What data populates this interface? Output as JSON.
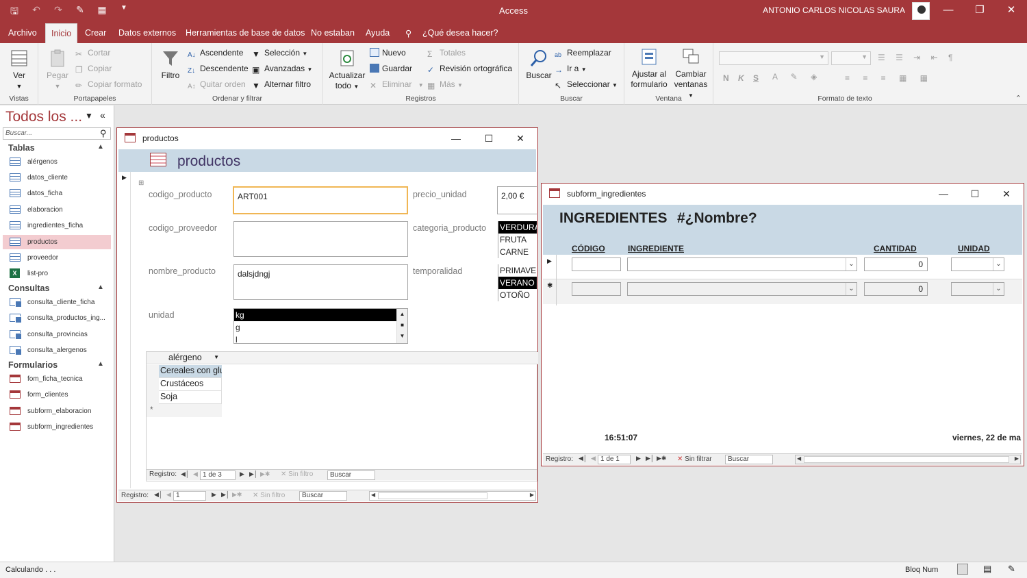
{
  "app": {
    "title": "Access",
    "user": "ANTONIO CARLOS NICOLAS SAURA"
  },
  "menu": [
    "Archivo",
    "Inicio",
    "Crear",
    "Datos externos",
    "Herramientas de base de datos",
    "No estaban",
    "Ayuda",
    "¿Qué desea hacer?"
  ],
  "ribbon": {
    "vistas": {
      "ver": "Ver",
      "label": "Vistas"
    },
    "portapapeles": {
      "pegar": "Pegar",
      "cortar": "Cortar",
      "copiar": "Copiar",
      "copiar_formato": "Copiar formato",
      "label": "Portapapeles"
    },
    "ordenar": {
      "filtro": "Filtro",
      "ascendente": "Ascendente",
      "descendente": "Descendente",
      "quitar_orden": "Quitar orden",
      "seleccion": "Selección",
      "avanzadas": "Avanzadas",
      "alternar": "Alternar filtro",
      "label": "Ordenar y filtrar"
    },
    "registros": {
      "actualizar": "Actualizar",
      "todo": "todo",
      "nuevo": "Nuevo",
      "guardar": "Guardar",
      "eliminar": "Eliminar",
      "totales": "Totales",
      "revision": "Revisión ortográfica",
      "mas": "Más",
      "label": "Registros"
    },
    "buscar": {
      "buscar": "Buscar",
      "reemplazar": "Reemplazar",
      "ir_a": "Ir a",
      "seleccionar": "Seleccionar",
      "label": "Buscar"
    },
    "ventana": {
      "ajustar": "Ajustar al",
      "formulario": "formulario",
      "cambiar": "Cambiar",
      "ventanas": "ventanas",
      "label": "Ventana"
    },
    "formato": {
      "n": "N",
      "k": "K",
      "s": "S",
      "label": "Formato de texto"
    }
  },
  "nav": {
    "title": "Todos los ...",
    "search_placeholder": "Buscar...",
    "sections": {
      "tablas": "Tablas",
      "consultas": "Consultas",
      "formularios": "Formularios"
    },
    "tablas": [
      "alérgenos",
      "datos_cliente",
      "datos_ficha",
      "elaboracion",
      "ingredientes_ficha",
      "productos",
      "proveedor",
      "list-pro"
    ],
    "consultas": [
      "consulta_cliente_ficha",
      "consulta_productos_ing...",
      "consulta_provincias",
      "consulta_alergenos"
    ],
    "formularios": [
      "fom_ficha_tecnica",
      "form_clientes",
      "subform_elaboracion",
      "subform_ingredientes"
    ]
  },
  "productos": {
    "window_title": "productos",
    "header": "productos",
    "labels": {
      "codigo_producto": "codigo_producto",
      "codigo_proveedor": "codigo_proveedor",
      "nombre_producto": "nombre_producto",
      "unidad": "unidad",
      "precio_unidad": "precio_unidad",
      "categoria_producto": "categoria_producto",
      "temporalidad": "temporalidad"
    },
    "values": {
      "codigo_producto": "ART001",
      "codigo_proveedor": "",
      "nombre_producto": "dalsjdngj",
      "precio_unidad": "2,00 €"
    },
    "unidad_options": [
      "kg",
      "g",
      "l"
    ],
    "categoria_options": [
      "VERDURA",
      "FRUTA",
      "CARNE"
    ],
    "temporalidad_options": [
      "PRIMAVE",
      "VERANO",
      "OTOÑO"
    ],
    "sub": {
      "column": "alérgeno",
      "rows": [
        "Cereales con glu",
        "Crustáceos",
        "Soja"
      ],
      "new_row": "*",
      "nav": {
        "registro": "Registro:",
        "pos": "1 de 3",
        "filtro": "Sin filtro",
        "buscar": "Buscar"
      }
    },
    "nav": {
      "registro": "Registro:",
      "pos": "1",
      "filtro": "Sin filtro",
      "buscar": "Buscar"
    }
  },
  "ingredientes": {
    "window_title": "subform_ingredientes",
    "heading": "INGREDIENTES",
    "heading_value": "#¿Nombre?",
    "columns": [
      "CÓDIGO",
      "INGREDIENTE",
      "CANTIDAD",
      "UNIDAD"
    ],
    "rows": [
      {
        "codigo": "",
        "ingrediente": "",
        "cantidad": "0",
        "unidad": ""
      },
      {
        "codigo": "",
        "ingrediente": "",
        "cantidad": "0",
        "unidad": ""
      }
    ],
    "time": "16:51:07",
    "date": "viernes, 22 de ma",
    "nav": {
      "registro": "Registro:",
      "pos": "1 de 1",
      "filtro": "Sin filtrar",
      "buscar": "Buscar"
    }
  },
  "status": {
    "left": "Calculando . . .",
    "right": "Bloq Num"
  },
  "colors": {
    "accent": "#a4373a",
    "header_blue": "#c9d9e5",
    "selected_nav": "#f3ccd0"
  }
}
